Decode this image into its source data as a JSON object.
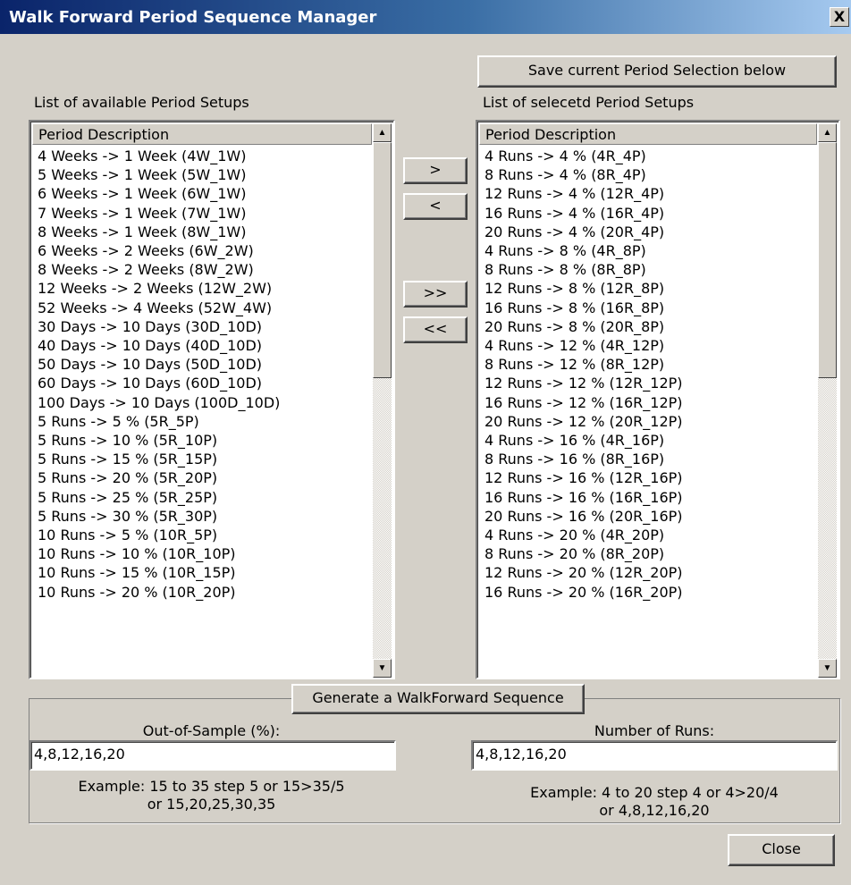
{
  "window": {
    "title": "Walk Forward Period Sequence Manager",
    "close_glyph": "X"
  },
  "save_button_label": "Save current Period Selection below",
  "available": {
    "label": "List of available Period Setups",
    "header": "Period Description",
    "items": [
      "4 Weeks -> 1 Week (4W_1W)",
      "5 Weeks -> 1 Week (5W_1W)",
      "6 Weeks -> 1 Week (6W_1W)",
      "7 Weeks -> 1 Week (7W_1W)",
      "8 Weeks -> 1 Week (8W_1W)",
      "6 Weeks -> 2 Weeks (6W_2W)",
      "8 Weeks -> 2 Weeks (8W_2W)",
      "12 Weeks -> 2 Weeks (12W_2W)",
      "52 Weeks -> 4 Weeks (52W_4W)",
      "30 Days -> 10 Days (30D_10D)",
      "40 Days -> 10 Days (40D_10D)",
      "50 Days -> 10 Days (50D_10D)",
      "60 Days -> 10 Days (60D_10D)",
      "100 Days -> 10 Days (100D_10D)",
      "5 Runs -> 5 % (5R_5P)",
      "5 Runs -> 10 % (5R_10P)",
      "5 Runs -> 15 % (5R_15P)",
      "5 Runs -> 20 % (5R_20P)",
      "5 Runs -> 25 % (5R_25P)",
      "5 Runs -> 30 % (5R_30P)",
      "10 Runs -> 5 % (10R_5P)",
      "10 Runs -> 10 % (10R_10P)",
      "10 Runs -> 15 % (10R_15P)",
      "10 Runs -> 20 % (10R_20P)"
    ]
  },
  "selected": {
    "label": "List of selecetd Period Setups",
    "header": "Period Description",
    "items": [
      "4 Runs -> 4 % (4R_4P)",
      "8 Runs -> 4 % (8R_4P)",
      "12 Runs -> 4 % (12R_4P)",
      "16 Runs -> 4 % (16R_4P)",
      "20 Runs -> 4 % (20R_4P)",
      "4 Runs -> 8 % (4R_8P)",
      "8 Runs -> 8 % (8R_8P)",
      "12 Runs -> 8 % (12R_8P)",
      "16 Runs -> 8 % (16R_8P)",
      "20 Runs -> 8 % (20R_8P)",
      "4 Runs -> 12 % (4R_12P)",
      "8 Runs -> 12 % (8R_12P)",
      "12 Runs -> 12 % (12R_12P)",
      "16 Runs -> 12 % (16R_12P)",
      "20 Runs -> 12 % (20R_12P)",
      "4 Runs -> 16 % (4R_16P)",
      "8 Runs -> 16 % (8R_16P)",
      "12 Runs -> 16 % (12R_16P)",
      "16 Runs -> 16 % (16R_16P)",
      "20 Runs -> 16 % (20R_16P)",
      "4 Runs -> 20 % (4R_20P)",
      "8 Runs -> 20 % (8R_20P)",
      "12 Runs -> 20 % (12R_20P)",
      "16 Runs -> 20 % (16R_20P)"
    ]
  },
  "transfer_buttons": {
    "add": ">",
    "remove": "<",
    "add_all": ">>",
    "remove_all": "<<"
  },
  "scroll_glyphs": {
    "up": "▲",
    "down": "▼"
  },
  "generate": {
    "button_label": "Generate a WalkForward Sequence",
    "oos_label": "Out-of-Sample (%):",
    "oos_value": "4,8,12,16,20",
    "oos_example_line1": "Example: 15 to 35 step 5  or 15>35/5",
    "oos_example_line2": "or 15,20,25,30,35",
    "runs_label": "Number of Runs:",
    "runs_value": "4,8,12,16,20",
    "runs_example_line1": "Example: 4 to 20 step 4  or 4>20/4",
    "runs_example_line2": "or 4,8,12,16,20"
  },
  "close_button_label": "Close"
}
